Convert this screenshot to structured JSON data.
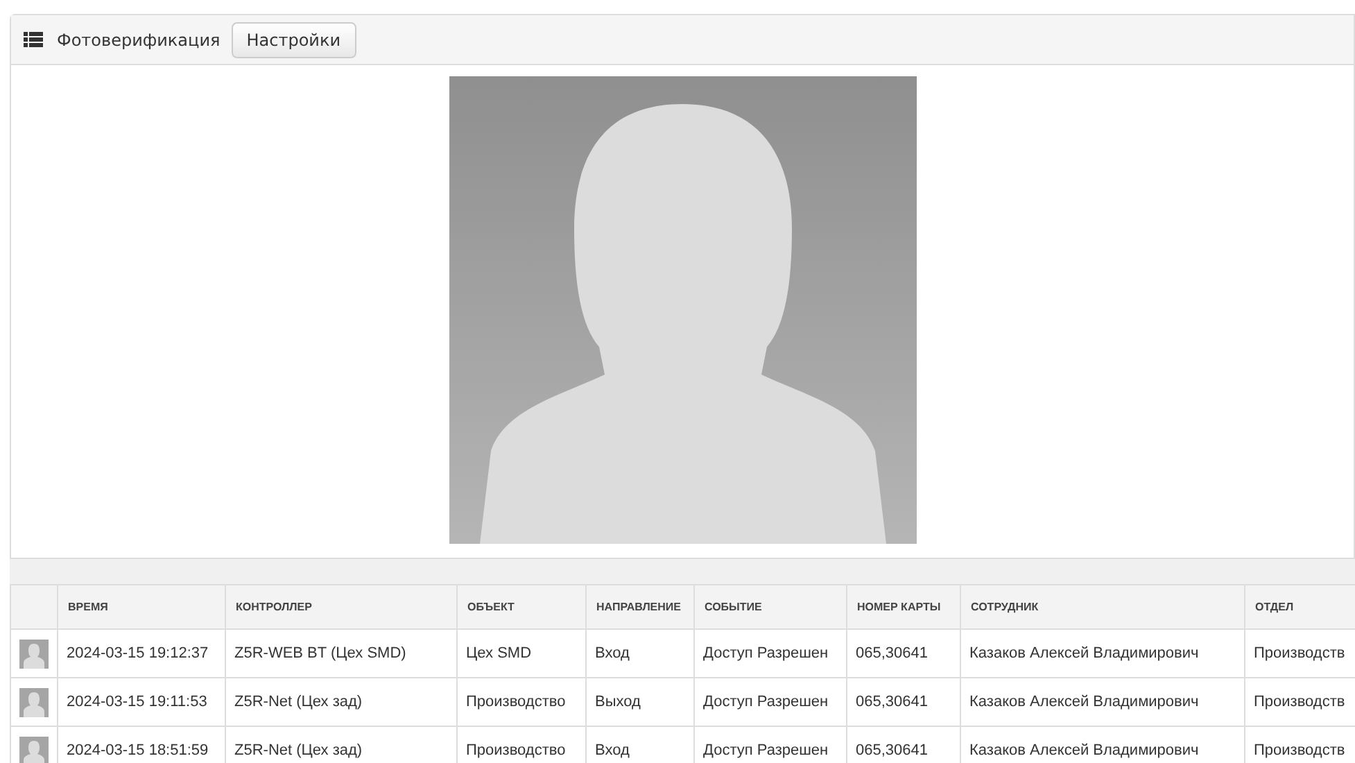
{
  "panel": {
    "title": "Фотоверификация",
    "settings_button": "Настройки"
  },
  "table": {
    "columns": [
      "ВРЕМЯ",
      "КОНТРОЛЛЕР",
      "ОБЪЕКТ",
      "НАПРАВЛЕНИЕ",
      "СОБЫТИЕ",
      "НОМЕР КАРТЫ",
      "СОТРУДНИК",
      "ОТДЕЛ"
    ],
    "rows": [
      {
        "cells": [
          "2024-03-15 19:12:37",
          "Z5R-WEB BT (Цех SMD)",
          "Цех SMD",
          "Вход",
          "Доступ Разрешен",
          "065,30641",
          "Казаков Алексей Владимирович",
          "Производств"
        ]
      },
      {
        "cells": [
          "2024-03-15 19:11:53",
          "Z5R-Net (Цех зад)",
          "Производство",
          "Выход",
          "Доступ Разрешен",
          "065,30641",
          "Казаков Алексей Владимирович",
          "Производств"
        ]
      },
      {
        "cells": [
          "2024-03-15 18:51:59",
          "Z5R-Net (Цех зад)",
          "Производство",
          "Вход",
          "Доступ Разрешен",
          "065,30641",
          "Казаков Алексей Владимирович",
          "Производств"
        ]
      }
    ]
  }
}
